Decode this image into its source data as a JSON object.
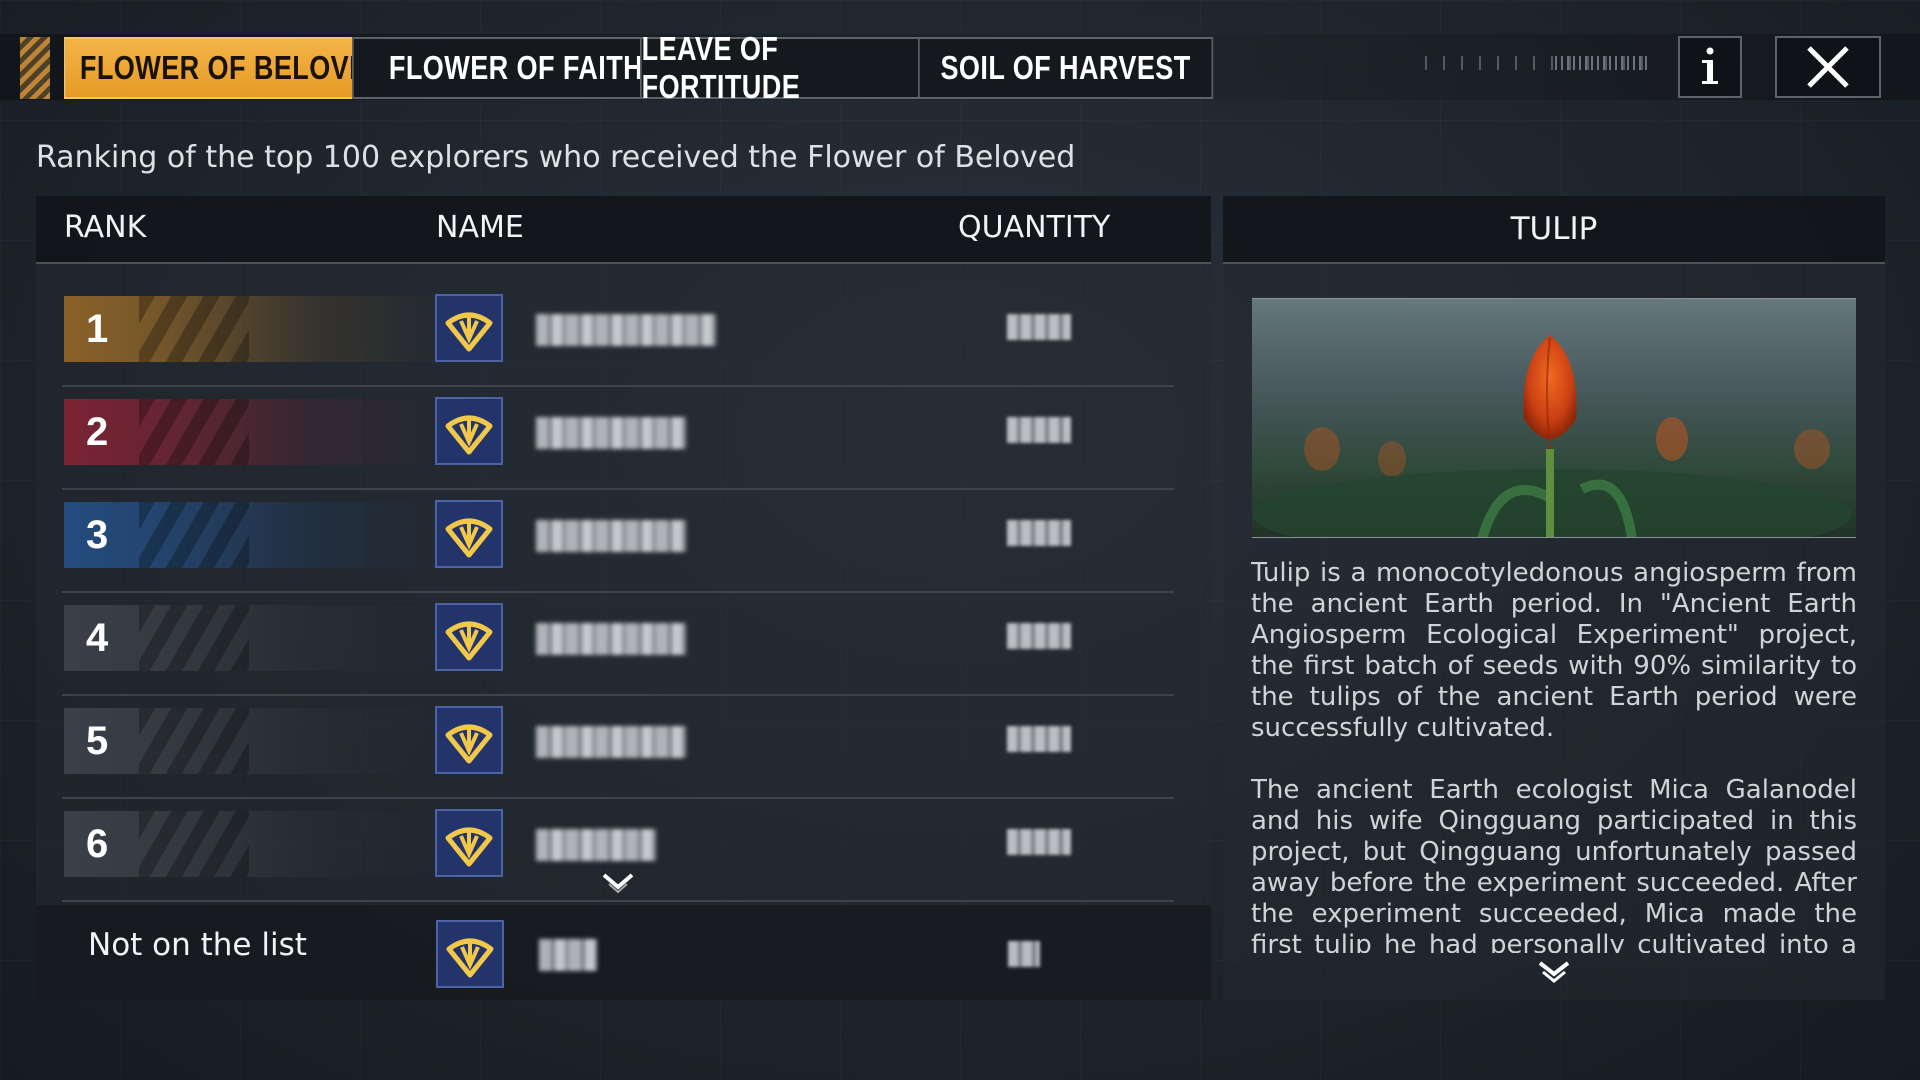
{
  "tabs": [
    {
      "label": "FLOWER OF BELOVED",
      "active": true
    },
    {
      "label": "FLOWER OF FAITH",
      "active": false
    },
    {
      "label": "LEAVE OF FORTITUDE",
      "active": false
    },
    {
      "label": "SOIL OF HARVEST",
      "active": false
    }
  ],
  "icons": {
    "info": "info-icon",
    "close": "close-icon",
    "avatar": "emblem-icon",
    "scroll": "chevron-down-icon"
  },
  "subtitle": "Ranking of the top 100 explorers who received the Flower of Beloved",
  "table": {
    "headers": {
      "rank": "RANK",
      "name": "NAME",
      "quantity": "QUANTITY"
    },
    "rows": [
      {
        "rank": "1",
        "color": "#8a6229"
      },
      {
        "rank": "2",
        "color": "#7a2434"
      },
      {
        "rank": "3",
        "color": "#244c7e"
      },
      {
        "rank": "4",
        "color": "#3b4048"
      },
      {
        "rank": "5",
        "color": "#3b4048"
      },
      {
        "rank": "6",
        "color": "#3b4048"
      }
    ],
    "self_row": {
      "label": "Not on the list"
    }
  },
  "detail": {
    "title": "TULIP",
    "paragraphs": [
      "Tulip is a monocotyledonous angiosperm from the ancient Earth period. In \"Ancient Earth Angiosperm Ecological Experiment\" project, the first batch of seeds with 90% similarity to the tulips of the ancient Earth period were successfully cultivated.",
      "The ancient Earth ecologist Mica Galanodel and his wife Qingguang participated in this project, but Qingguang unfortunately passed away before the experiment succeeded. After the experiment succeeded, Mica made the first tulip he had personally cultivated into a specimen and"
    ]
  },
  "colors": {
    "accent": "#f0a833",
    "avatar_bg": "#22346a",
    "avatar_emblem": "#f2c84b"
  }
}
